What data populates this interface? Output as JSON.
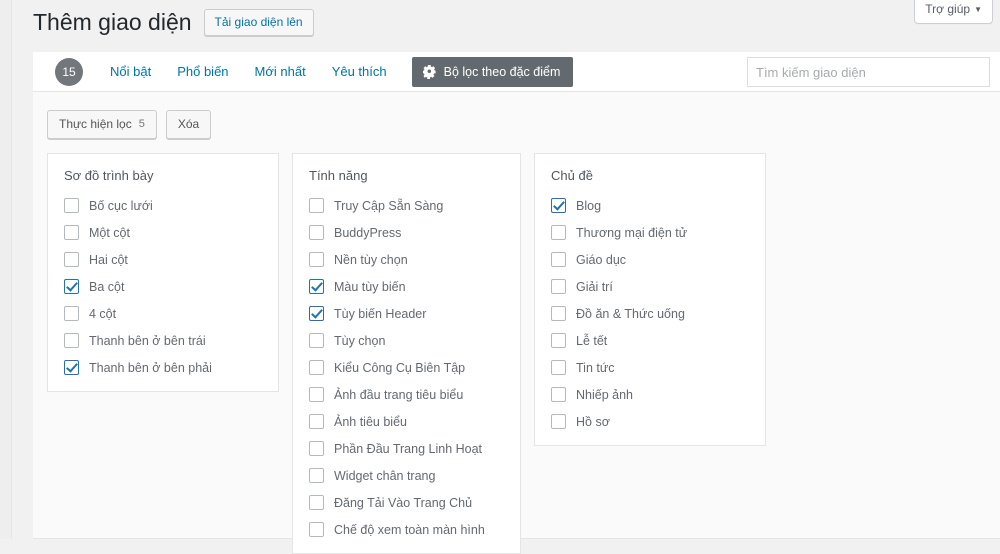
{
  "help_tab": {
    "label": "Trợ giúp",
    "caret": "▼"
  },
  "header": {
    "page_title": "Thêm giao diện",
    "upload_button": "Tải giao diện lên"
  },
  "navbar": {
    "count": "15",
    "tabs": [
      {
        "label": "Nổi bật",
        "active": false
      },
      {
        "label": "Phổ biến",
        "active": false
      },
      {
        "label": "Mới nhất",
        "active": false
      },
      {
        "label": "Yêu thích",
        "active": false
      }
    ],
    "feature_filter_button": "Bộ lọc theo đặc điểm",
    "feature_filter_icon": "gear-icon",
    "search_placeholder": "Tìm kiếm giao diện",
    "search_value": ""
  },
  "filter_actions": {
    "apply_label": "Thực hiện lọc",
    "apply_count": "5",
    "clear_label": "Xóa"
  },
  "filter_groups": [
    {
      "title": "Sơ đồ trình bày",
      "items": [
        {
          "label": "Bố cục lưới",
          "checked": false
        },
        {
          "label": "Một cột",
          "checked": false
        },
        {
          "label": "Hai cột",
          "checked": false
        },
        {
          "label": "Ba cột",
          "checked": true
        },
        {
          "label": "4 cột",
          "checked": false
        },
        {
          "label": "Thanh bên ở bên trái",
          "checked": false
        },
        {
          "label": "Thanh bên ở bên phải",
          "checked": true
        }
      ]
    },
    {
      "title": "Tính năng",
      "items": [
        {
          "label": "Truy Cập Sẵn Sàng",
          "checked": false
        },
        {
          "label": "BuddyPress",
          "checked": false
        },
        {
          "label": "Nền tùy chọn",
          "checked": false
        },
        {
          "label": "Màu tùy biến",
          "checked": true
        },
        {
          "label": "Tùy biến Header",
          "checked": true
        },
        {
          "label": "Tùy chọn",
          "checked": false
        },
        {
          "label": "Kiểu Công Cụ Biên Tập",
          "checked": false
        },
        {
          "label": "Ảnh đầu trang tiêu biểu",
          "checked": false
        },
        {
          "label": "Ảnh tiêu biểu",
          "checked": false
        },
        {
          "label": "Phần Đầu Trang Linh Hoạt",
          "checked": false
        },
        {
          "label": "Widget chân trang",
          "checked": false
        },
        {
          "label": "Đăng Tải Vào Trang Chủ",
          "checked": false
        },
        {
          "label": "Chế độ xem toàn màn hình",
          "checked": false
        }
      ]
    },
    {
      "title": "Chủ đề",
      "items": [
        {
          "label": "Blog",
          "checked": true
        },
        {
          "label": "Thương mại điện tử",
          "checked": false
        },
        {
          "label": "Giáo dục",
          "checked": false
        },
        {
          "label": "Giải trí",
          "checked": false
        },
        {
          "label": "Đồ ăn & Thức uống",
          "checked": false
        },
        {
          "label": "Lễ tết",
          "checked": false
        },
        {
          "label": "Tin tức",
          "checked": false
        },
        {
          "label": "Nhiếp ảnh",
          "checked": false
        },
        {
          "label": "Hồ sơ",
          "checked": false
        }
      ]
    }
  ],
  "colors": {
    "accent_link": "#0073aa",
    "checked_blue": "#2271b1",
    "filter_button_bg": "#636a6f",
    "count_badge_bg": "#72777c",
    "page_bg": "#f1f1f1"
  }
}
